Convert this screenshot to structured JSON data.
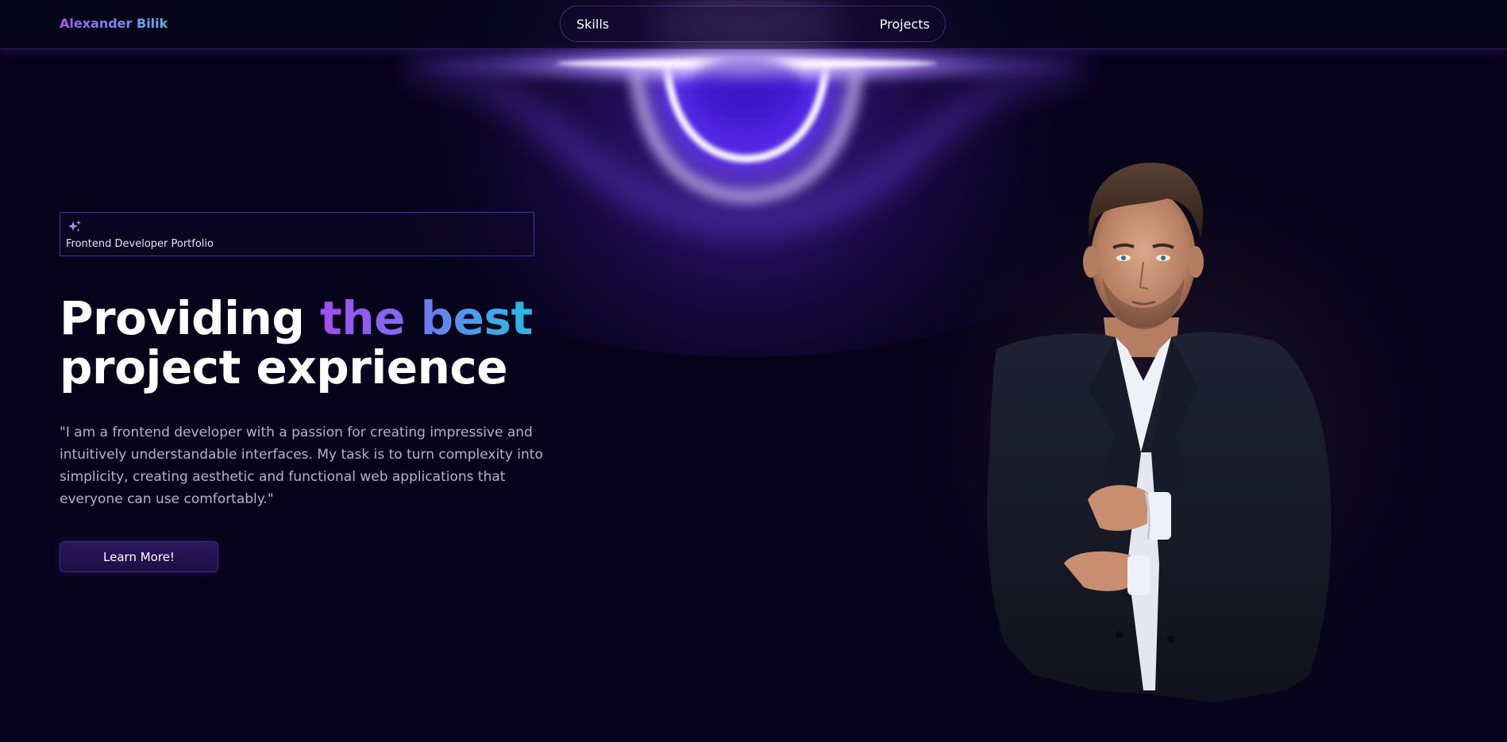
{
  "header": {
    "logo": "Alexander Bilik",
    "nav": {
      "skills": "Skills",
      "projects": "Projects"
    }
  },
  "hero": {
    "badge": {
      "icon": "sparkle-icon",
      "label": "Frontend Developer Portfolio"
    },
    "title": {
      "part1": "Providing ",
      "accent": "the best",
      "part2": "project exprience"
    },
    "description": "\"I am a frontend developer with a passion for creating impressive and intuitively understandable interfaces. My task is to turn complexity into simplicity, creating aesthetic and functional web applications that everyone can use comfortably.\"",
    "cta": "Learn More!"
  },
  "colors": {
    "background": "#06031a",
    "accent_purple": "#8b5cf6",
    "accent_blue": "#2bb6e2",
    "button_bg": "#241256"
  }
}
